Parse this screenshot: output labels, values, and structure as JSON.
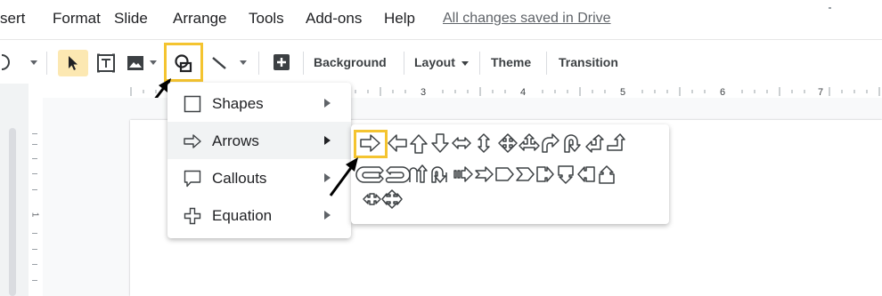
{
  "menubar": {
    "items": [
      "sert",
      "Format",
      "Slide",
      "Arrange",
      "Tools",
      "Add-ons",
      "Help"
    ],
    "saved_status": "All changes saved in Drive"
  },
  "toolbar": {
    "background_label": "Background",
    "layout_label": "Layout",
    "theme_label": "Theme",
    "transition_label": "Transition"
  },
  "ruler": {
    "numbers": [
      "3",
      "4",
      "5",
      "6",
      "7"
    ],
    "vertical_number": "1"
  },
  "shape_menu": {
    "items": [
      {
        "label": "Shapes",
        "icon": "square-icon"
      },
      {
        "label": "Arrows",
        "icon": "arrow-right-outline-icon"
      },
      {
        "label": "Callouts",
        "icon": "callout-icon"
      },
      {
        "label": "Equation",
        "icon": "plus-outline-icon"
      }
    ],
    "active": "Arrows"
  },
  "arrows_submenu": {
    "icons": [
      "right-arrow-icon",
      "left-arrow-icon",
      "up-arrow-icon",
      "down-arrow-icon",
      "left-right-arrow-icon",
      "up-down-arrow-icon",
      "quad-arrow-icon",
      "left-right-up-arrow-icon",
      "bent-arrow-icon",
      "u-turn-arrow-icon",
      "left-up-arrow-icon",
      "bent-up-arrow-icon",
      "curved-right-arrow-icon",
      "curved-left-arrow-icon",
      "curved-up-arrow-icon",
      "curved-down-arrow-icon",
      "striped-right-arrow-icon",
      "notched-right-arrow-icon",
      "pentagon-arrow-icon",
      "chevron-arrow-icon",
      "right-arrow-callout-icon",
      "down-arrow-callout-icon",
      "left-arrow-callout-icon",
      "up-arrow-callout-icon",
      "left-right-arrow-callout-icon",
      "quad-arrow-callout-icon"
    ],
    "highlight": "right-arrow-icon"
  },
  "colors": {
    "highlight": "#f4c430",
    "menu_active": "#f1f3f4",
    "icon_stroke": "#3c4043"
  }
}
